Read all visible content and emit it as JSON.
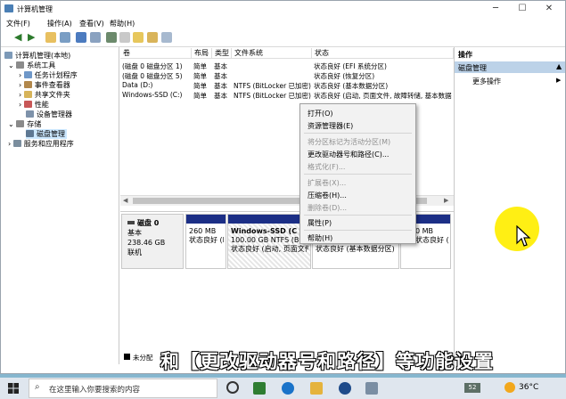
{
  "window": {
    "title": "计算机管理"
  },
  "menu": [
    "文件(F)",
    "操作(A)",
    "查看(V)",
    "帮助(H)"
  ],
  "tree": {
    "root": "计算机管理(本地)",
    "system_tools": "系统工具",
    "task_scheduler": "任务计划程序",
    "event_viewer": "事件查看器",
    "shared_folders": "共享文件夹",
    "performance": "性能",
    "device_manager": "设备管理器",
    "storage": "存储",
    "disk_management": "磁盘管理",
    "services": "服务和应用程序"
  },
  "volume_table": {
    "columns": [
      "卷",
      "布局",
      "类型",
      "文件系统",
      "状态"
    ],
    "rows": [
      [
        "(磁盘 0 磁盘分区 1)",
        "简单",
        "基本",
        "",
        "状态良好 (EFI 系统分区)"
      ],
      [
        "(磁盘 0 磁盘分区 5)",
        "简单",
        "基本",
        "",
        "状态良好 (恢复分区)"
      ],
      [
        "Data (D:)",
        "简单",
        "基本",
        "NTFS (BitLocker 已加密)",
        "状态良好 (基本数据分区)"
      ],
      [
        "Windows-SSD (C:)",
        "简单",
        "基本",
        "NTFS (BitLocker 已加密)",
        "状态良好 (启动, 页面文件, 故障转储, 基本数据分区)"
      ]
    ]
  },
  "disk0": {
    "name": "磁盘 0",
    "type": "基本",
    "size": "238.46 GB",
    "status": "联机",
    "partitions": [
      {
        "l1": "",
        "l2": "260 MB",
        "l3": "状态良好 (E"
      },
      {
        "l1": "Windows-SSD (C",
        "l2": "100.00 GB NTFS (B",
        "l3": "状态良好 (启动, 页面文件"
      },
      {
        "l1": "",
        "l2": "",
        "l3": "状态良好 (基本数据分区)"
      },
      {
        "l1": "",
        "l2": "0 MB",
        "l3": "状态良好 (I"
      }
    ]
  },
  "legend": {
    "unallocated": "未分配"
  },
  "actions": {
    "header": "操作",
    "section": "磁盘管理",
    "more": "更多操作"
  },
  "context_menu": [
    {
      "label": "打开(O)",
      "disabled": false
    },
    {
      "label": "资源管理器(E)",
      "disabled": false
    },
    {
      "label": "将分区标记为活动分区(M)",
      "disabled": true
    },
    {
      "label": "更改驱动器号和路径(C)...",
      "disabled": false
    },
    {
      "label": "格式化(F)...",
      "disabled": true
    },
    {
      "label": "扩展卷(X)...",
      "disabled": true
    },
    {
      "label": "压缩卷(H)...",
      "disabled": false
    },
    {
      "label": "删除卷(D)...",
      "disabled": true
    },
    {
      "label": "属性(P)",
      "disabled": false
    },
    {
      "label": "帮助(H)",
      "disabled": false
    }
  ],
  "caption": "和【更改驱动器号和路径】等功能设置",
  "taskbar": {
    "search_placeholder": "在这里输入你要搜索的内容",
    "temperature": "36°C",
    "badge": "52"
  },
  "colors": {
    "partition_bar": "#1c2f86",
    "highlight": "#ffee00",
    "selection": "#cce8ff"
  }
}
